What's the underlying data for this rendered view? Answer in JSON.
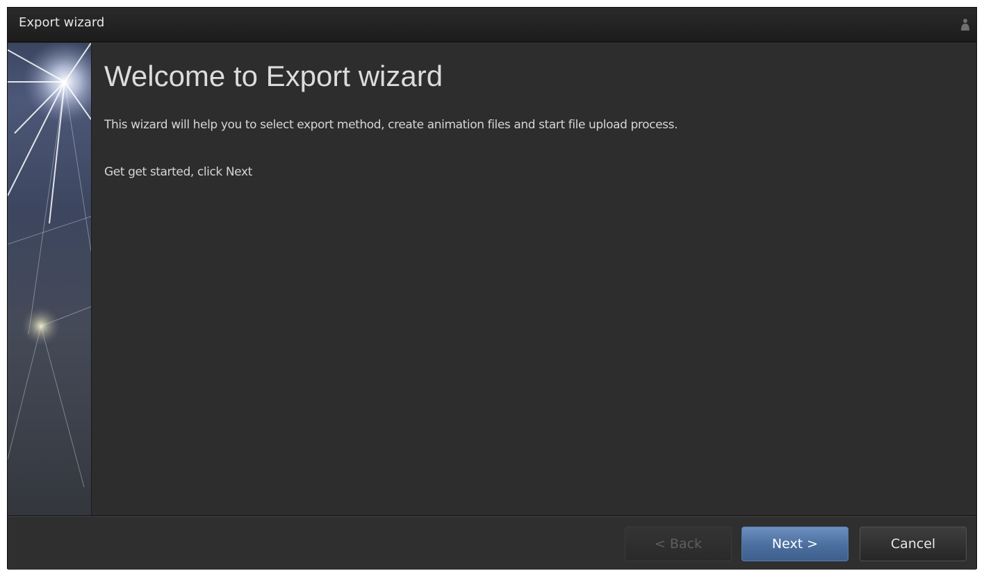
{
  "window": {
    "title": "Export wizard"
  },
  "main": {
    "heading": "Welcome to Export wizard",
    "description": "This wizard will help you to select export method, create animation files and start file upload process.",
    "hint": "Get get started, click Next"
  },
  "buttons": {
    "back": "< Back",
    "next": "Next >",
    "cancel": "Cancel"
  },
  "icons": {
    "title_icon": "app-icon",
    "sidebar_art": "starburst-image"
  },
  "colors": {
    "background": "#2d2d2d",
    "accent": "#4a6e9e",
    "text": "#d6d6d6"
  }
}
